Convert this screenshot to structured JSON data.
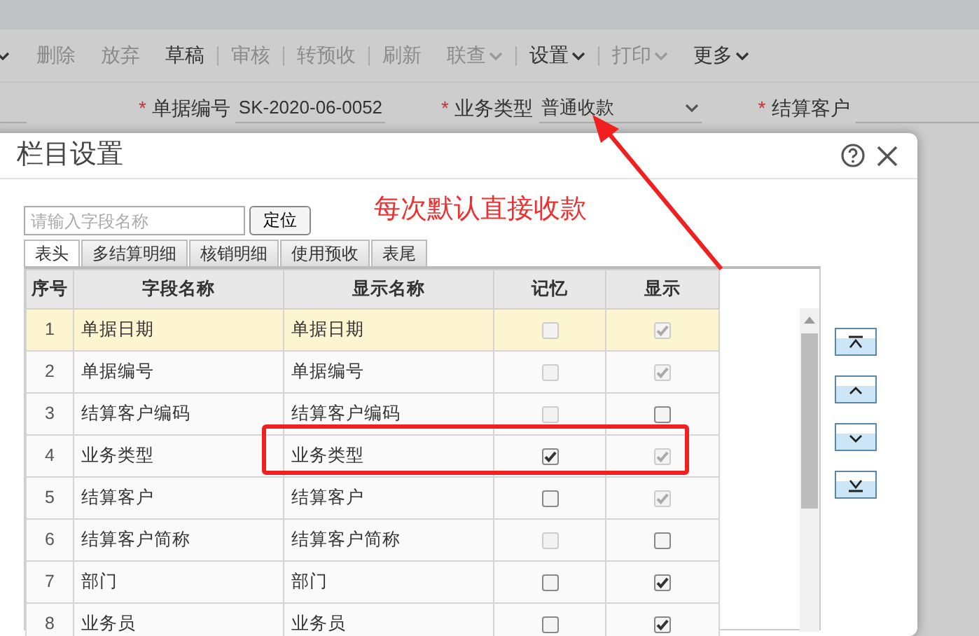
{
  "toolbar": {
    "items": [
      {
        "label": "删除",
        "disabled": true,
        "dropdown": false,
        "separator_before": false
      },
      {
        "label": "放弃",
        "disabled": true,
        "dropdown": false,
        "separator_before": false
      },
      {
        "label": "草稿",
        "disabled": false,
        "dropdown": false,
        "separator_before": false
      },
      {
        "label": "审核",
        "disabled": true,
        "dropdown": false,
        "separator_before": true
      },
      {
        "label": "转预收",
        "disabled": true,
        "dropdown": false,
        "separator_before": true
      },
      {
        "label": "刷新",
        "disabled": true,
        "dropdown": false,
        "separator_before": true
      },
      {
        "label": "联查",
        "disabled": true,
        "dropdown": true,
        "separator_before": false
      },
      {
        "label": "设置",
        "disabled": false,
        "dropdown": true,
        "separator_before": true
      },
      {
        "label": "打印",
        "disabled": true,
        "dropdown": true,
        "separator_before": true
      },
      {
        "label": "更多",
        "disabled": false,
        "dropdown": true,
        "separator_before": false
      }
    ]
  },
  "form": {
    "fields": [
      {
        "required_mark": "*",
        "label": "单据编号",
        "value": "SK-2020-06-0052",
        "kind": "text"
      },
      {
        "required_mark": "*",
        "label": "业务类型",
        "value": "普通收款",
        "kind": "select"
      },
      {
        "required_mark": "*",
        "label": "结算客户",
        "kind": "text"
      }
    ]
  },
  "dialog": {
    "title": "栏目设置",
    "search": {
      "placeholder": "请输入字段名称",
      "button": "定位"
    },
    "tabs": [
      {
        "label": "表头",
        "selected": true
      },
      {
        "label": "多结算明细",
        "selected": false
      },
      {
        "label": "核销明细",
        "selected": false
      },
      {
        "label": "使用预收",
        "selected": false
      },
      {
        "label": "表尾",
        "selected": false
      }
    ],
    "table": {
      "columns": [
        "序号",
        "字段名称",
        "显示名称",
        "记忆",
        "显示"
      ],
      "rows": [
        {
          "no": "1",
          "field": "单据日期",
          "display_name": "单据日期",
          "selected": true,
          "remember": {
            "checked": false,
            "disabled": true
          },
          "show": {
            "checked": true,
            "disabled": true
          }
        },
        {
          "no": "2",
          "field": "单据编号",
          "display_name": "单据编号",
          "selected": false,
          "remember": {
            "checked": false,
            "disabled": true
          },
          "show": {
            "checked": true,
            "disabled": true
          }
        },
        {
          "no": "3",
          "field": "结算客户编码",
          "display_name": "结算客户编码",
          "selected": false,
          "remember": {
            "checked": false,
            "disabled": true
          },
          "show": {
            "checked": false,
            "disabled": false
          }
        },
        {
          "no": "4",
          "field": "业务类型",
          "display_name": "业务类型",
          "selected": false,
          "remember": {
            "checked": true,
            "disabled": false
          },
          "show": {
            "checked": true,
            "disabled": true
          }
        },
        {
          "no": "5",
          "field": "结算客户",
          "display_name": "结算客户",
          "selected": false,
          "remember": {
            "checked": false,
            "disabled": false
          },
          "show": {
            "checked": true,
            "disabled": true
          }
        },
        {
          "no": "6",
          "field": "结算客户简称",
          "display_name": "结算客户简称",
          "selected": false,
          "remember": {
            "checked": false,
            "disabled": true
          },
          "show": {
            "checked": false,
            "disabled": false
          }
        },
        {
          "no": "7",
          "field": "部门",
          "display_name": "部门",
          "selected": false,
          "remember": {
            "checked": false,
            "disabled": false
          },
          "show": {
            "checked": true,
            "disabled": false
          }
        },
        {
          "no": "8",
          "field": "业务员",
          "display_name": "业务员",
          "selected": false,
          "remember": {
            "checked": false,
            "disabled": false
          },
          "show": {
            "checked": true,
            "disabled": false
          }
        }
      ]
    },
    "move_buttons": [
      {
        "kind": "top"
      },
      {
        "kind": "up"
      },
      {
        "kind": "down"
      },
      {
        "kind": "bottom"
      }
    ]
  },
  "annotation": {
    "note": "每次默认直接收款"
  }
}
